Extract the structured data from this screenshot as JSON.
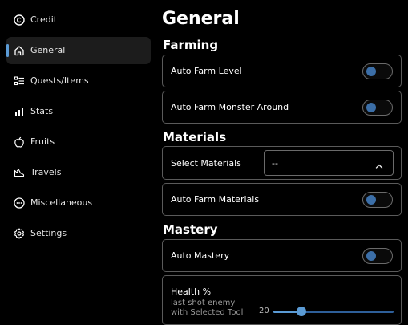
{
  "sidebar": {
    "items": [
      {
        "label": "Credit",
        "icon": "credit-icon"
      },
      {
        "label": "General",
        "icon": "home-icon",
        "active": true
      },
      {
        "label": "Quests/Items",
        "icon": "list-icon"
      },
      {
        "label": "Stats",
        "icon": "bar-chart-icon"
      },
      {
        "label": "Fruits",
        "icon": "apple-icon"
      },
      {
        "label": "Travels",
        "icon": "travel-icon"
      },
      {
        "label": "Miscellaneous",
        "icon": "dots-icon"
      },
      {
        "label": "Settings",
        "icon": "gear-icon"
      }
    ]
  },
  "main": {
    "title": "General",
    "sections": {
      "farming": {
        "title": "Farming",
        "rows": [
          {
            "label": "Auto Farm Level",
            "enabled": false
          },
          {
            "label": "Auto Farm Monster Around",
            "enabled": false
          }
        ]
      },
      "materials": {
        "title": "Materials",
        "select_label": "Select Materials",
        "select_value": "--",
        "rows": [
          {
            "label": "Auto Farm Materials",
            "enabled": false
          }
        ]
      },
      "mastery": {
        "title": "Mastery",
        "rows": [
          {
            "label": "Auto Mastery",
            "enabled": false
          }
        ],
        "health": {
          "label": "Health %",
          "description": "last shot enemy with Selected Tool",
          "description_lines": [
            "last shot enemy",
            "with Selected Tool"
          ],
          "value": "20",
          "level": 0.23
        }
      }
    }
  },
  "colors": {
    "accent": "#5b9bd5",
    "toggle_knob": "#3c6fa8",
    "border": "#5a5a5a",
    "active_bg": "#1c1c1c"
  }
}
